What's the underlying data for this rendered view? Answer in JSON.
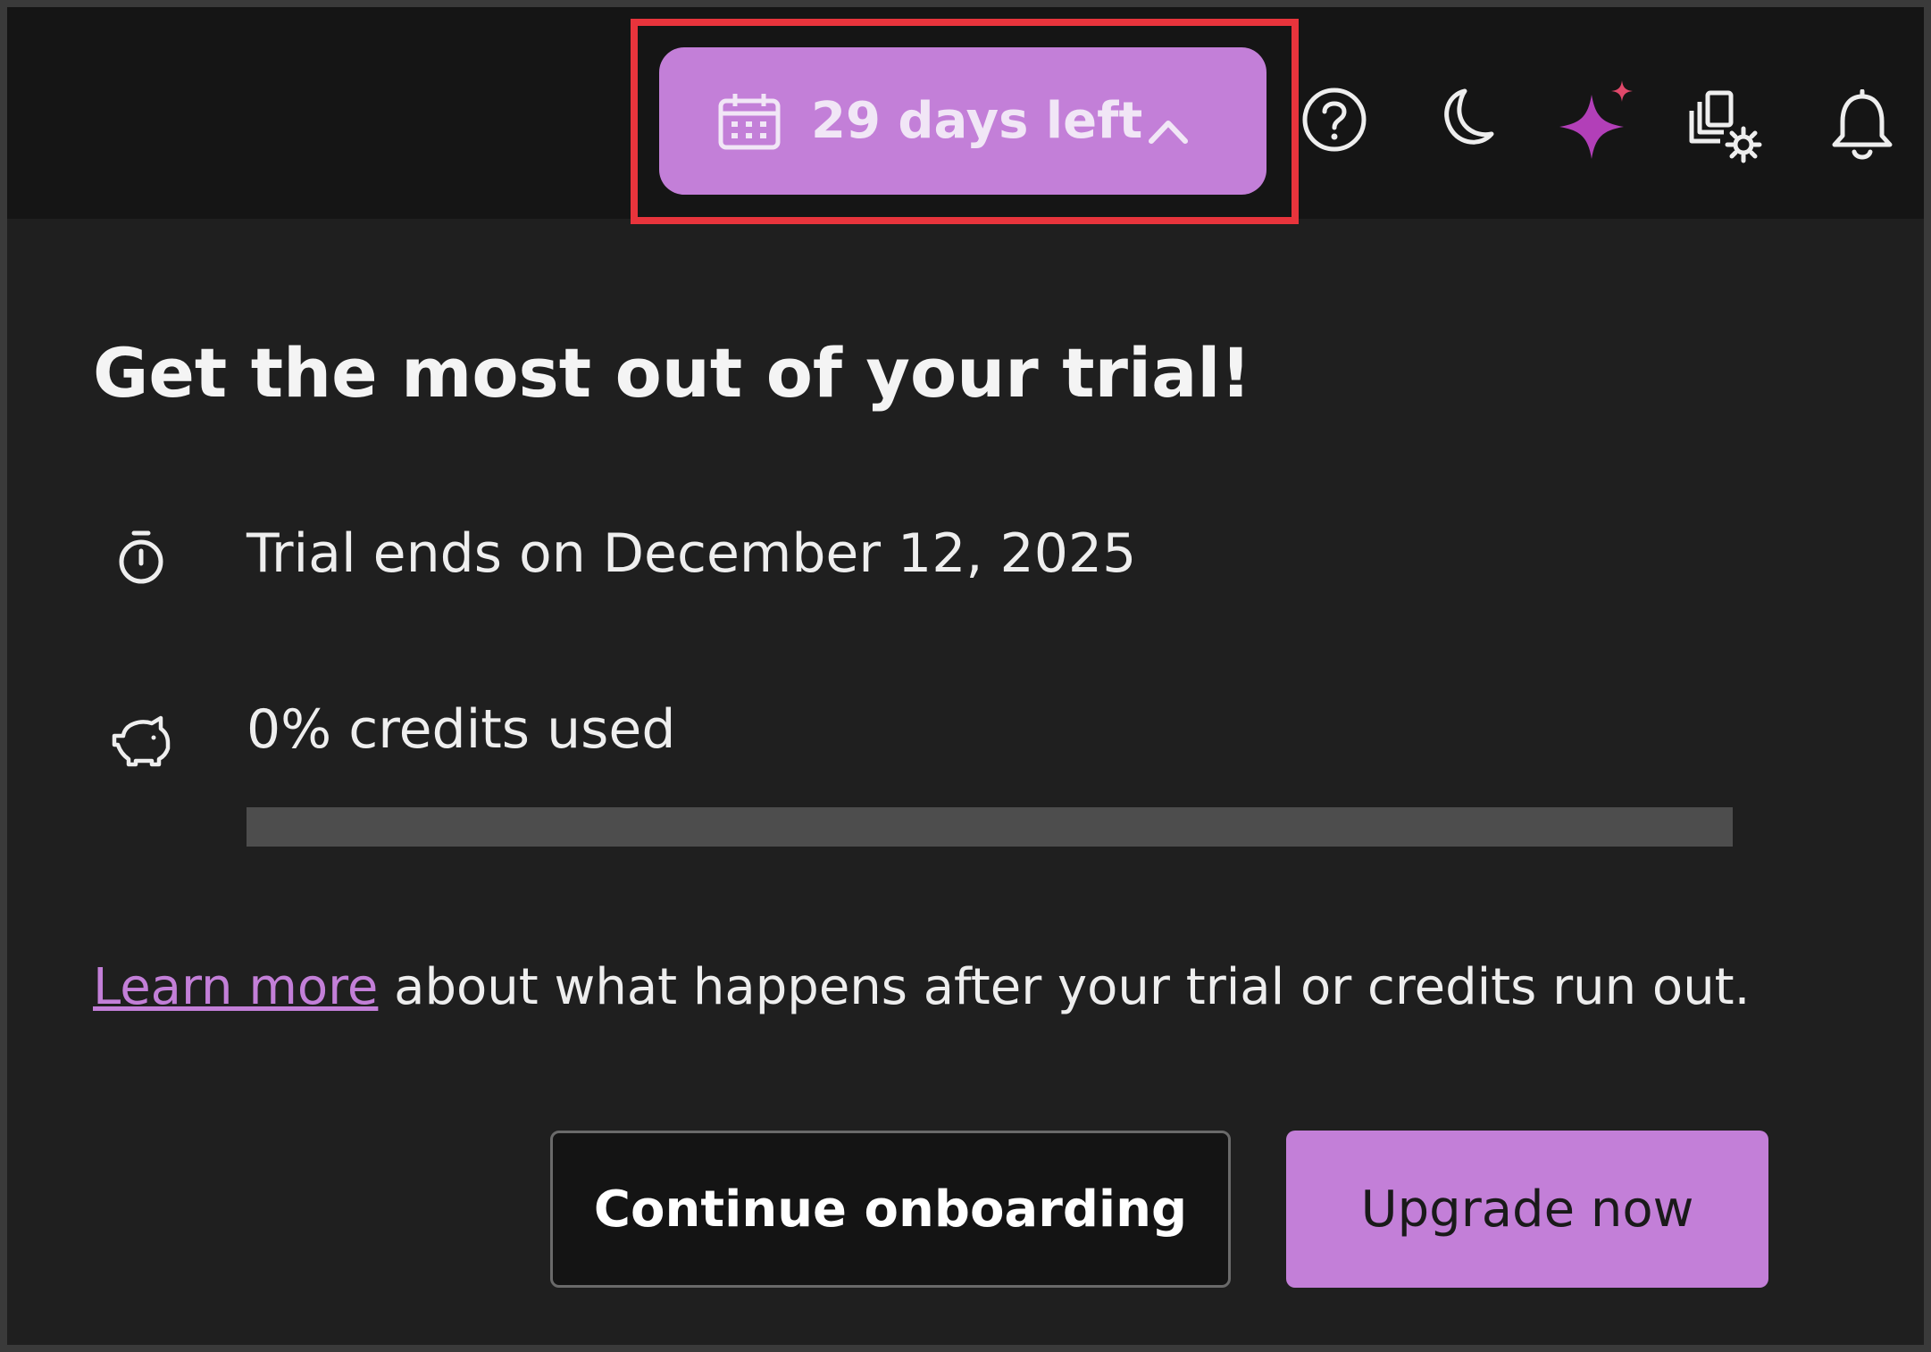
{
  "topbar": {
    "trial_button": {
      "label": "29 days left",
      "icon": "calendar-icon",
      "chevron": "chevron-up-icon"
    },
    "icons": [
      "help-icon",
      "moon-icon",
      "ai-sparkle-icon",
      "workspace-settings-icon",
      "bell-icon"
    ]
  },
  "panel": {
    "title": "Get the most out of your trial!",
    "trial_end": {
      "icon": "stopwatch-icon",
      "text": "Trial ends on December 12, 2025"
    },
    "credits": {
      "icon": "piggy-bank-icon",
      "text": "0% credits used",
      "used_fraction": 0
    },
    "learn": {
      "link_text": "Learn more",
      "rest_text": " about what happens after your trial or credits run out."
    },
    "buttons": {
      "continue": "Continue onboarding",
      "upgrade": "Upgrade now"
    }
  },
  "colors": {
    "accent": "#c37fd8",
    "highlight_border": "#e8343c",
    "panel_bg": "#1f1f1f",
    "topbar_bg": "#151515"
  }
}
